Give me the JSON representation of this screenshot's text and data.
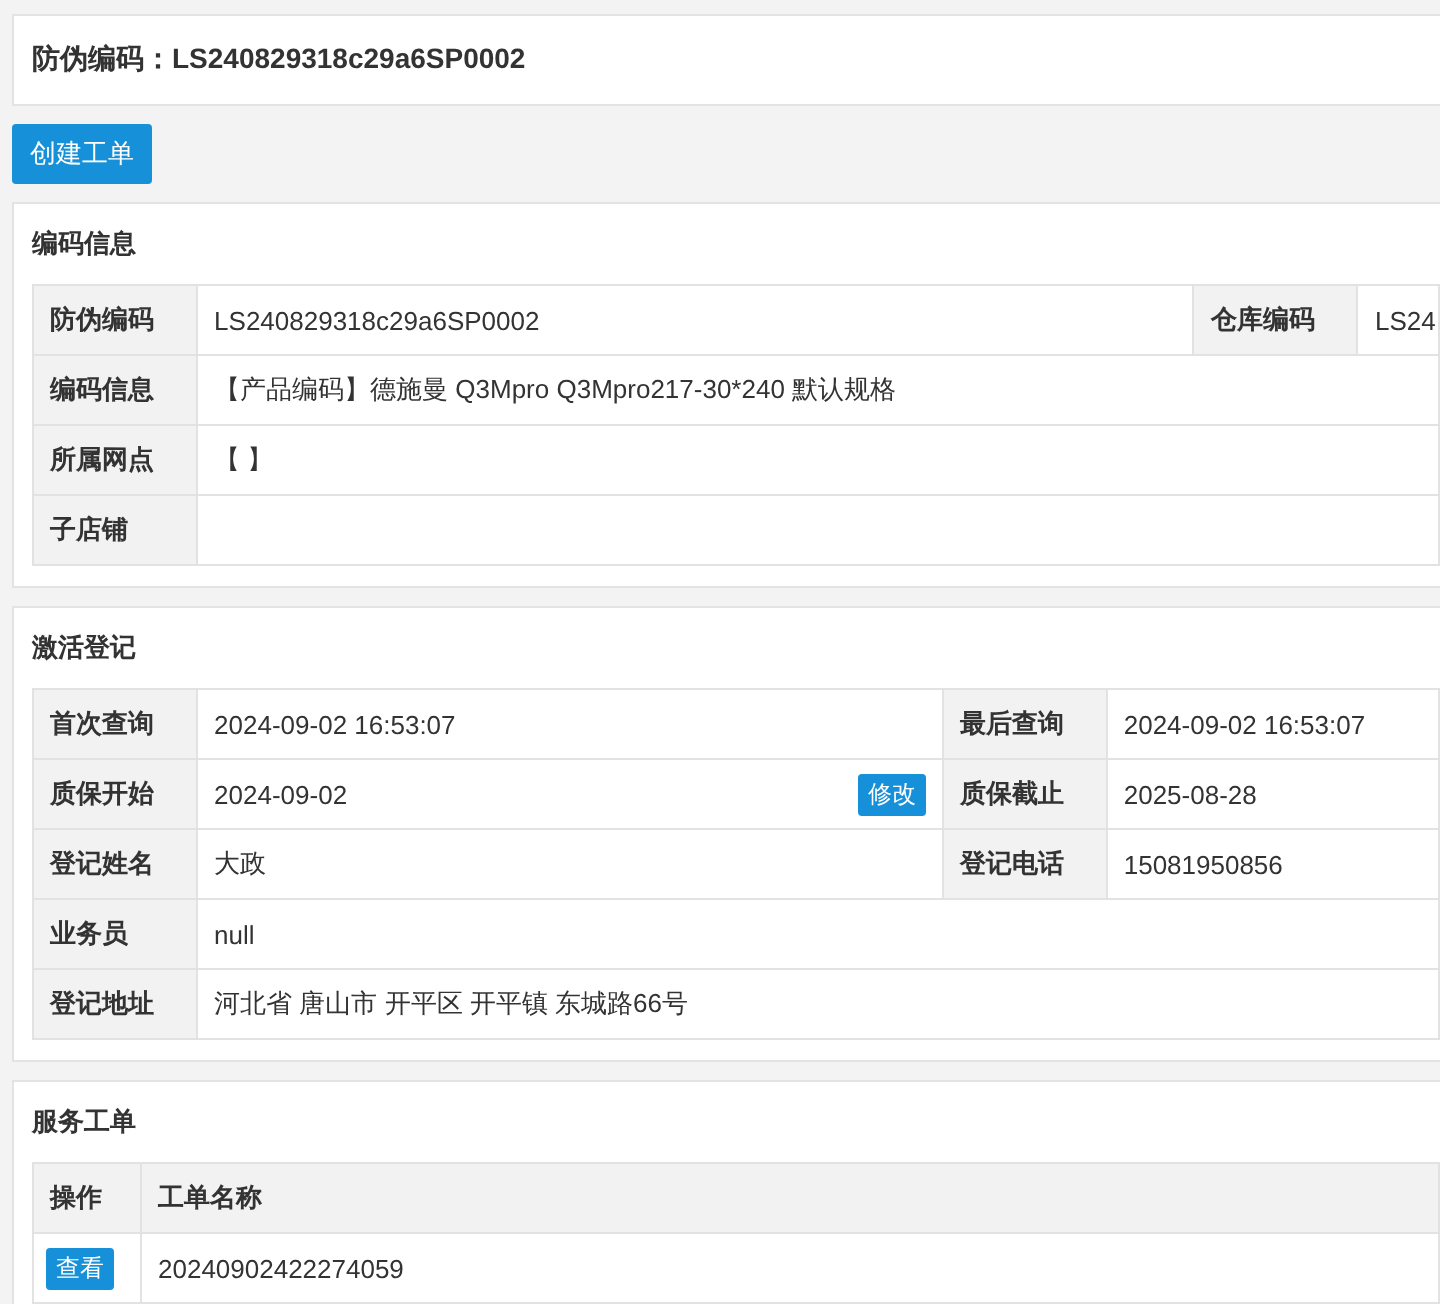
{
  "header": {
    "title": "防伪编码：LS240829318c29a6SP0002"
  },
  "create_button": "创建工单",
  "code_info": {
    "title": "编码信息",
    "rows": [
      {
        "cells": [
          {
            "label": "防伪编码",
            "value": "LS240829318c29a6SP0002"
          },
          {
            "label": "仓库编码",
            "value": "LS24"
          }
        ]
      },
      {
        "cells": [
          {
            "label": "编码信息",
            "value": "【产品编码】德施曼 Q3Mpro Q3Mpro217-30*240 默认规格"
          }
        ]
      },
      {
        "cells": [
          {
            "label": "所属网点",
            "value": "【 】"
          }
        ]
      },
      {
        "cells": [
          {
            "label": "子店铺"
          }
        ]
      }
    ]
  },
  "activation": {
    "title": "激活登记",
    "rows": [
      {
        "cells": [
          {
            "label": "首次查询",
            "value": "2024-09-02 16:53:07"
          },
          {
            "label": "最后查询",
            "value": "2024-09-02 16:53:07"
          }
        ]
      },
      {
        "cells": [
          {
            "label": "质保开始",
            "value": "2024-09-02",
            "action": "修改"
          },
          {
            "label": "质保截止",
            "value": "2025-08-28"
          }
        ]
      },
      {
        "cells": [
          {
            "label": "登记姓名",
            "value": "大政"
          },
          {
            "label": "登记电话",
            "value": "15081950856"
          }
        ]
      },
      {
        "cells": [
          {
            "label": "业务员",
            "value": "null"
          }
        ]
      },
      {
        "cells": [
          {
            "label": "登记地址",
            "value": "河北省 唐山市 开平区 开平镇 东城路66号"
          }
        ]
      }
    ]
  },
  "work_orders": {
    "title": "服务工单",
    "columns": [
      "操作",
      "工单名称"
    ],
    "rows": [
      {
        "action": "查看",
        "name": "20240902422274059"
      }
    ]
  }
}
